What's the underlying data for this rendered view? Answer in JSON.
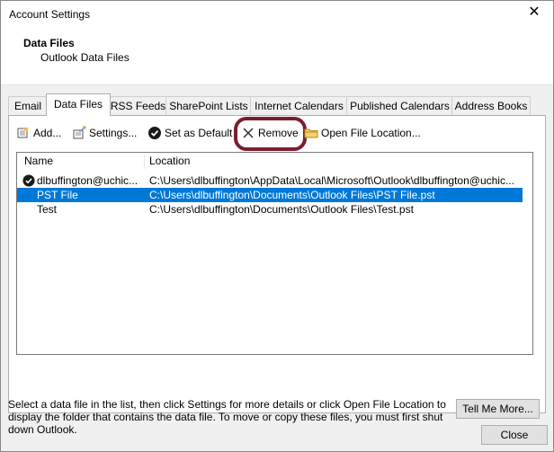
{
  "window": {
    "title": "Account Settings",
    "close_icon": "close-icon"
  },
  "header": {
    "title": "Data Files",
    "subtitle": "Outlook Data Files"
  },
  "tabs": [
    {
      "label": "Email"
    },
    {
      "label": "Data Files"
    },
    {
      "label": "RSS Feeds"
    },
    {
      "label": "SharePoint Lists"
    },
    {
      "label": "Internet Calendars"
    },
    {
      "label": "Published Calendars"
    },
    {
      "label": "Address Books"
    }
  ],
  "toolbar": {
    "add": "Add...",
    "settings": "Settings...",
    "set_default": "Set as Default",
    "remove": "Remove",
    "open_location": "Open File Location..."
  },
  "list": {
    "columns": {
      "name": "Name",
      "location": "Location"
    },
    "rows": [
      {
        "name": "dlbuffington@uchic...",
        "location": "C:\\Users\\dlbuffington\\AppData\\Local\\Microsoft\\Outlook\\dlbuffington@uchic...",
        "default": true,
        "selected": false
      },
      {
        "name": "PST File",
        "location": "C:\\Users\\dlbuffington\\Documents\\Outlook Files\\PST File.pst",
        "default": false,
        "selected": true
      },
      {
        "name": "Test",
        "location": "C:\\Users\\dlbuffington\\Documents\\Outlook Files\\Test.pst",
        "default": false,
        "selected": false
      }
    ]
  },
  "description": "Select a data file in the list, then click Settings for more details or click Open File Location to display the folder that contains the data file. To move or copy these files, you must first shut down Outlook.",
  "buttons": {
    "tell_me_more": "Tell Me More...",
    "close": "Close"
  },
  "colors": {
    "selection": "#0078d7",
    "highlight_ring": "#7a1e2c"
  }
}
